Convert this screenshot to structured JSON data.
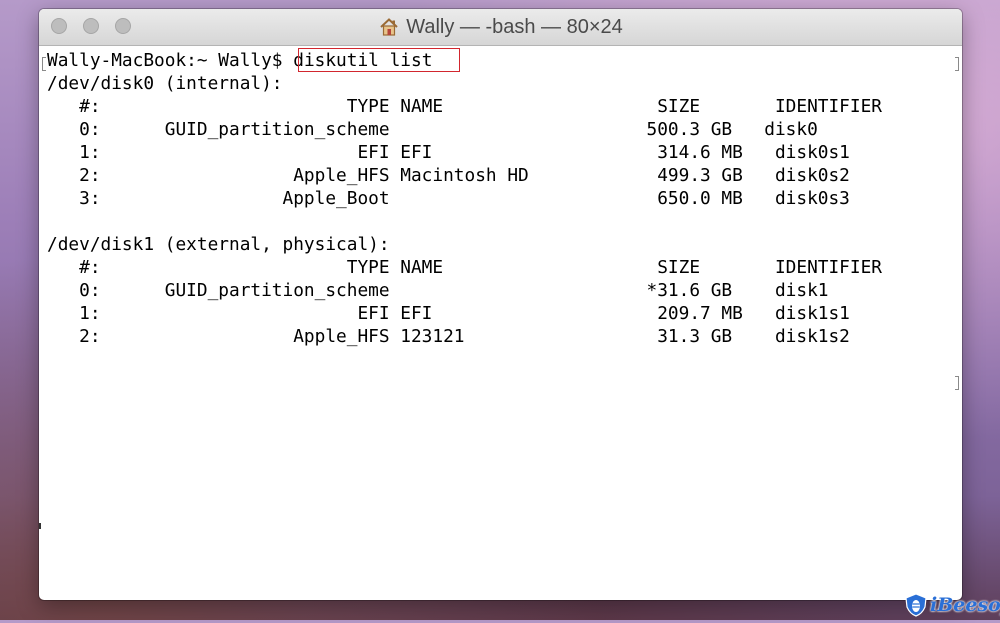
{
  "window": {
    "title": "Wally — -bash — 80×24",
    "icon": "home-icon"
  },
  "terminal": {
    "prompt": "Wally-MacBook:~ Wally$ ",
    "command": "diskutil list",
    "lines": [
      "/dev/disk0 (internal):",
      "   #:                       TYPE NAME                    SIZE       IDENTIFIER",
      "   0:      GUID_partition_scheme                        500.3 GB   disk0",
      "   1:                        EFI EFI                     314.6 MB   disk0s1",
      "   2:                  Apple_HFS Macintosh HD            499.3 GB   disk0s2",
      "   3:                 Apple_Boot                         650.0 MB   disk0s3",
      "",
      "/dev/disk1 (external, physical):",
      "   #:                       TYPE NAME                    SIZE       IDENTIFIER",
      "   0:      GUID_partition_scheme                        *31.6 GB    disk1",
      "   1:                        EFI EFI                     209.7 MB   disk1s1",
      "   2:                  Apple_HFS 123121                  31.3 GB    disk1s2"
    ]
  },
  "colors": {
    "highlight_border": "#d2262e",
    "watermark_blue": "#2a6fd6"
  },
  "watermark": {
    "text": "iBeesoft",
    "icon": "bee-shield-logo"
  }
}
